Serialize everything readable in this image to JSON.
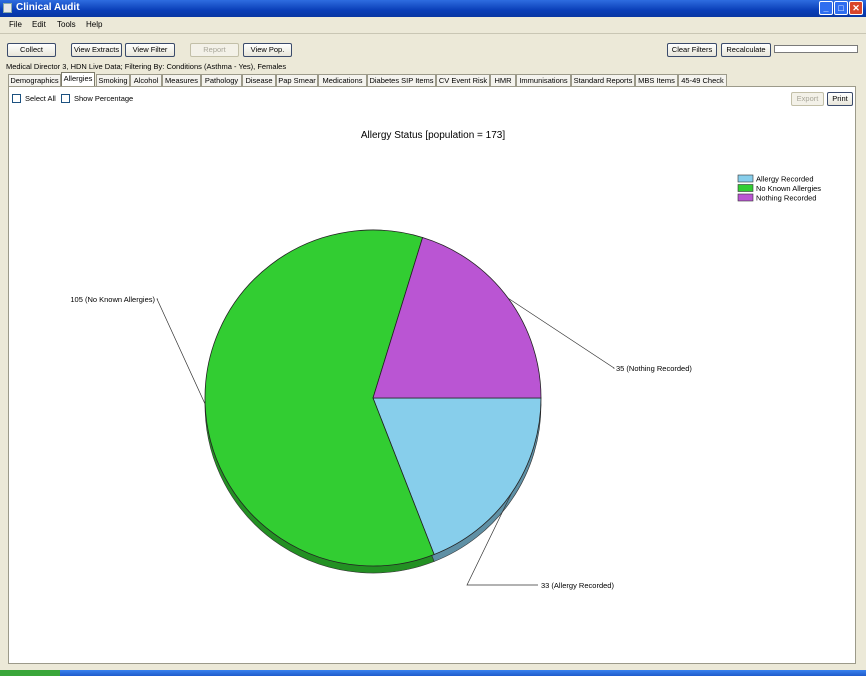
{
  "window": {
    "title": "Clinical Audit",
    "minimize": "_",
    "maximize": "□",
    "close": "✕"
  },
  "menu": [
    "File",
    "Edit",
    "Tools",
    "Help"
  ],
  "toolbar": {
    "collect": "Collect",
    "view_extracts": "View Extracts",
    "view_filter": "View Filter",
    "report": "Report",
    "view_pop": "View Pop.",
    "clear_filters": "Clear Filters",
    "recalculate": "Recalculate"
  },
  "filter_text": "Medical Director 3, HDN Live Data; Filtering By: Conditions (Asthma - Yes), Females",
  "tabs": [
    "Demographics",
    "Allergies",
    "Smoking",
    "Alcohol",
    "Measures",
    "Pathology",
    "Disease",
    "Pap Smear",
    "Medications",
    "Diabetes SIP Items",
    "CV Event Risk",
    "HMR",
    "Immunisations",
    "Standard Reports",
    "MBS Items",
    "45-49 Check"
  ],
  "active_tab": "Allergies",
  "options": {
    "select_all": "Select All",
    "show_percentage": "Show Percentage"
  },
  "actions": {
    "export": "Export",
    "print": "Print"
  },
  "chart_data": {
    "type": "pie",
    "title": "Allergy Status [population = 173]",
    "legend_position": "top-right",
    "slices": [
      {
        "label": "Allergy Recorded",
        "value": 33,
        "color": "#87ceeb",
        "data_label": "33 (Allergy Recorded)"
      },
      {
        "label": "No Known Allergies",
        "value": 105,
        "color": "#32cd32",
        "data_label": "105 (No Known Allergies)"
      },
      {
        "label": "Nothing Recorded",
        "value": 35,
        "color": "#ba55d3",
        "data_label": "35 (Nothing Recorded)"
      }
    ]
  }
}
